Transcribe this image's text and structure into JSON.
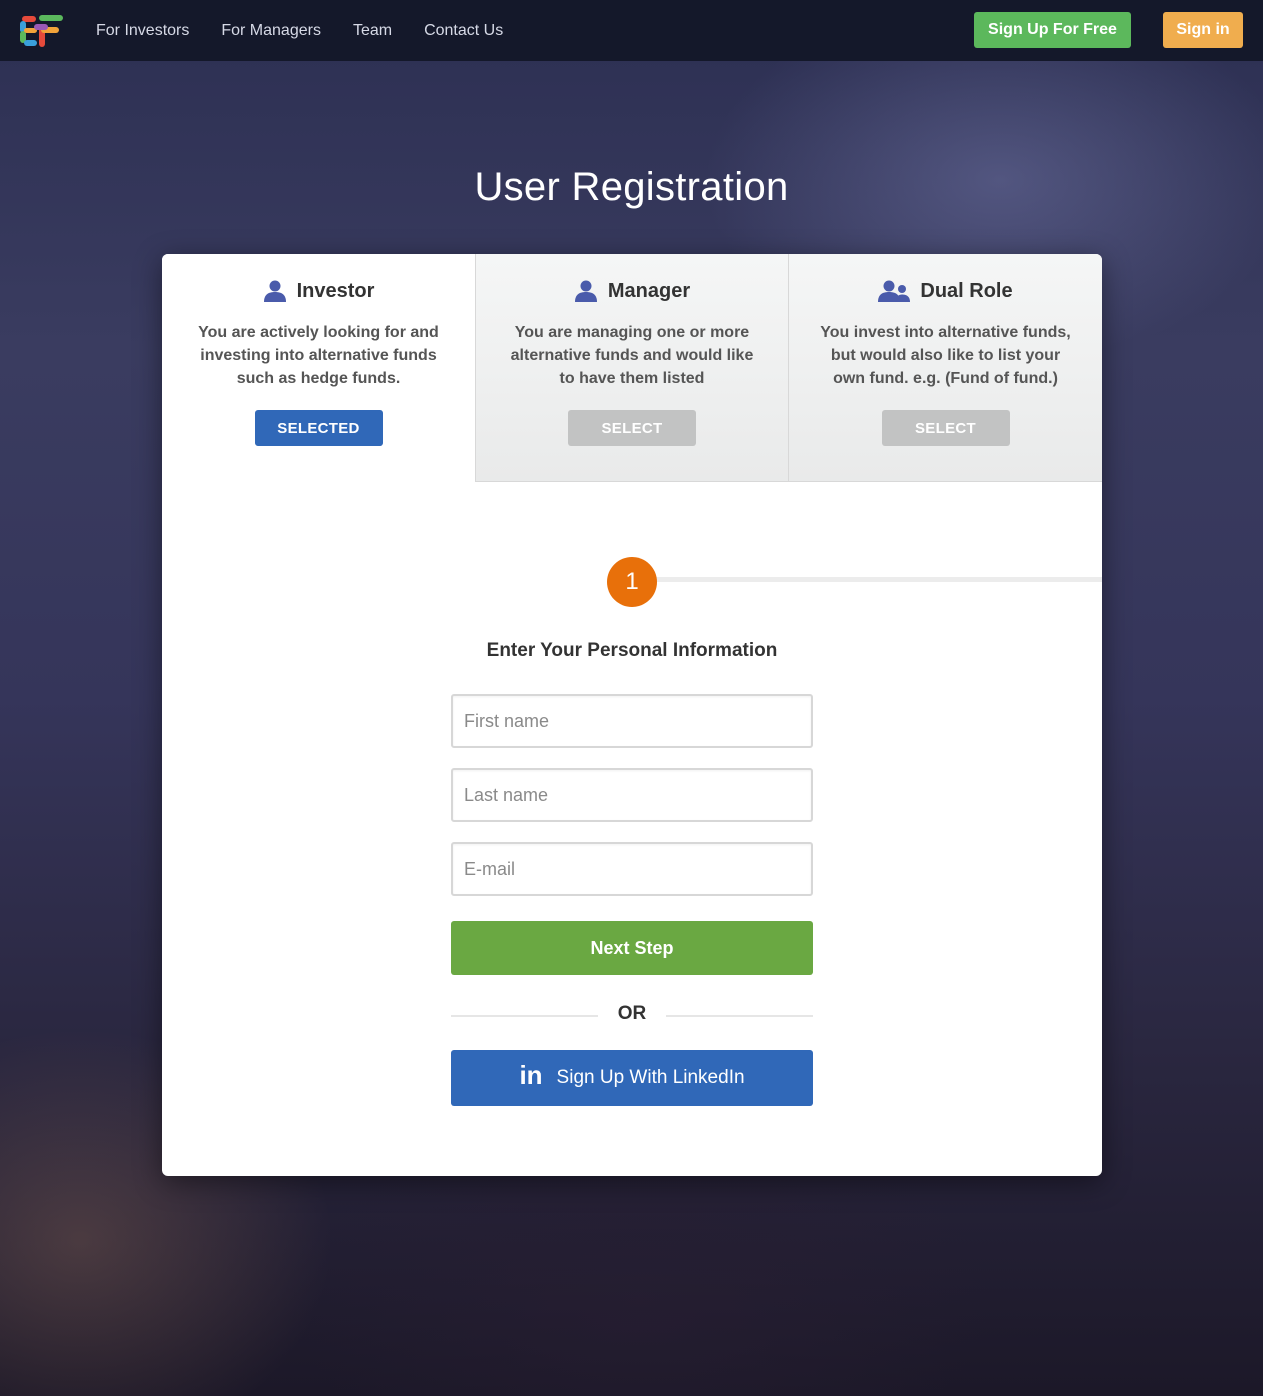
{
  "nav": {
    "items": [
      {
        "label": "For Investors"
      },
      {
        "label": "For Managers"
      },
      {
        "label": "Team"
      },
      {
        "label": "Contact Us"
      }
    ],
    "signup_label": "Sign Up For Free",
    "signin_label": "Sign in"
  },
  "page": {
    "title": "User Registration"
  },
  "roles": [
    {
      "title": "Investor",
      "description": "You are actively looking for and investing into alternative funds such as hedge funds.",
      "button": "SELECTED",
      "icon": "user-icon"
    },
    {
      "title": "Manager",
      "description": "You are managing one or more alternative funds and would like to have them listed",
      "button": "SELECT",
      "icon": "user-icon"
    },
    {
      "title": "Dual Role",
      "description": "You invest into alternative funds, but would also like to list your own fund. e.g. (Fund of fund.)",
      "button": "SELECT",
      "icon": "users-icon"
    }
  ],
  "step": {
    "number": "1",
    "title": "Enter Your Personal Information"
  },
  "form": {
    "first_name_placeholder": "First name",
    "last_name_placeholder": "Last name",
    "email_placeholder": "E-mail",
    "next_label": "Next Step",
    "or_label": "OR",
    "linkedin_icon": "in",
    "linkedin_label": "Sign Up With LinkedIn"
  },
  "colors": {
    "accent_blue": "#3068b8",
    "green": "#6aa842",
    "signup_green": "#5cb85c",
    "signin_orange": "#f0ad4e",
    "step_orange": "#e8700a"
  }
}
